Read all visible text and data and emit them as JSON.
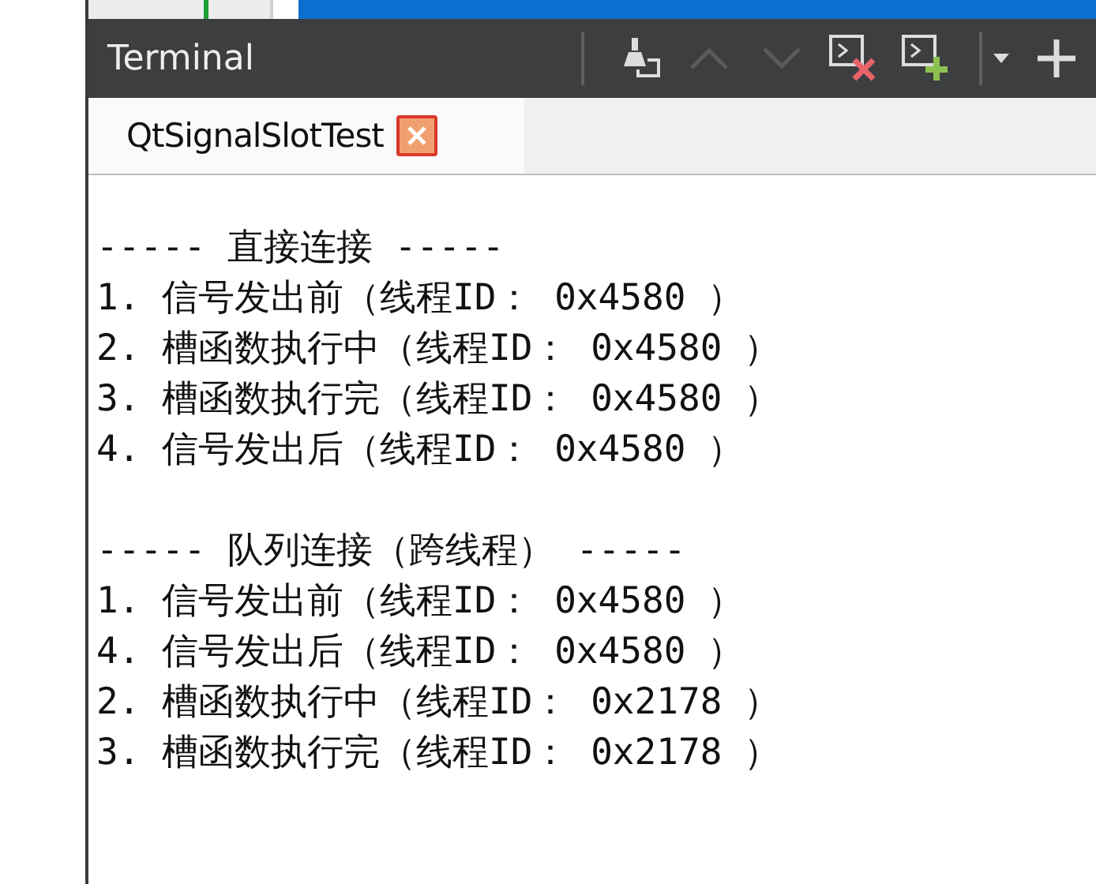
{
  "panel": {
    "title": "Terminal"
  },
  "toolbar": [
    {
      "kind": "clear",
      "disabled": false
    },
    {
      "kind": "up",
      "disabled": true
    },
    {
      "kind": "down",
      "disabled": true
    },
    {
      "kind": "close-terminal",
      "disabled": false
    },
    {
      "kind": "new-terminal",
      "disabled": false
    },
    {
      "kind": "dropdown",
      "disabled": false
    },
    {
      "kind": "add",
      "disabled": false
    }
  ],
  "tabs": [
    {
      "label": "QtSignalSlotTest",
      "selected": true
    }
  ],
  "output": [
    {
      "lines": [
        "----- 直接连接 -----",
        "1. 信号发出前（线程ID： 0x4580 ）",
        "2. 槽函数执行中（线程ID： 0x4580 ）",
        "3. 槽函数执行完（线程ID： 0x4580 ）",
        "4. 信号发出后（线程ID： 0x4580 ）"
      ]
    },
    {
      "lines": [
        "----- 队列连接（跨线程） -----",
        "1. 信号发出前（线程ID： 0x4580 ）",
        "4. 信号发出后（线程ID： 0x4580 ）",
        "2. 槽函数执行中（线程ID： 0x2178 ）",
        "3. 槽函数执行完（线程ID： 0x2178 ）"
      ]
    }
  ]
}
